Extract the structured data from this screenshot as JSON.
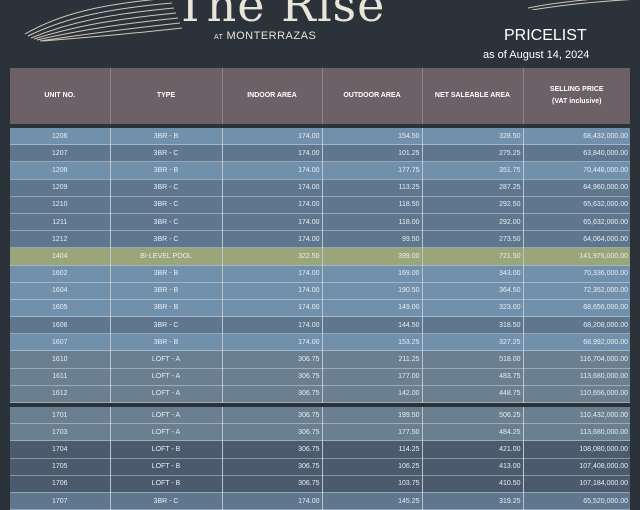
{
  "brand": {
    "title": "The Rise",
    "sub_prefix": "AT",
    "sub_name": "MONTERRAZAS"
  },
  "pricelist": {
    "title": "PRICELIST",
    "date": "as of August 14, 2024"
  },
  "colors": {
    "header_bg": "#2b323a",
    "column_header_bg": "#6b6166",
    "row_light": "#7190ac",
    "row_mid": "#5e778f",
    "row_slate": "#6a7f90",
    "row_dark": "#4b5a6d",
    "row_highlight": "#9aa57a"
  },
  "table": {
    "headers": [
      {
        "line1": "UNIT NO.",
        "line2": ""
      },
      {
        "line1": "TYPE",
        "line2": ""
      },
      {
        "line1": "INDOOR AREA",
        "line2": ""
      },
      {
        "line1": "OUTDOOR AREA",
        "line2": ""
      },
      {
        "line1": "NET SALEABLE AREA",
        "line2": ""
      },
      {
        "line1": "SELLING PRICE",
        "line2": "(VAT inclusive)"
      }
    ],
    "rows": [
      {
        "unit": "1206",
        "type": "3BR - B",
        "indoor": "174.00",
        "outdoor": "154.50",
        "net": "328.50",
        "price": "68,432,000.00",
        "shade": "light"
      },
      {
        "unit": "1207",
        "type": "3BR - C",
        "indoor": "174.00",
        "outdoor": "101.25",
        "net": "275.25",
        "price": "63,840,000.00",
        "shade": "mid"
      },
      {
        "unit": "1208",
        "type": "3BR - B",
        "indoor": "174.00",
        "outdoor": "177.75",
        "net": "351.75",
        "price": "70,448,000.00",
        "shade": "light"
      },
      {
        "unit": "1209",
        "type": "3BR - C",
        "indoor": "174.00",
        "outdoor": "113.25",
        "net": "287.25",
        "price": "64,960,000.00",
        "shade": "mid"
      },
      {
        "unit": "1210",
        "type": "3BR - C",
        "indoor": "174.00",
        "outdoor": "118.50",
        "net": "292.50",
        "price": "65,632,000.00",
        "shade": "mid"
      },
      {
        "unit": "1211",
        "type": "3BR - C",
        "indoor": "174.00",
        "outdoor": "118.00",
        "net": "292.00",
        "price": "65,632,000.00",
        "shade": "mid"
      },
      {
        "unit": "1212",
        "type": "3BR - C",
        "indoor": "174.00",
        "outdoor": "99.50",
        "net": "273.50",
        "price": "64,064,000.00",
        "shade": "mid"
      },
      {
        "unit": "1404",
        "type": "BI-LEVEL POOL",
        "indoor": "322.50",
        "outdoor": "399.00",
        "net": "721.50",
        "price": "141,976,000.00",
        "shade": "highlight"
      },
      {
        "unit": "1602",
        "type": "3BR - B",
        "indoor": "174.00",
        "outdoor": "169.00",
        "net": "343.00",
        "price": "70,336,000.00",
        "shade": "light"
      },
      {
        "unit": "1604",
        "type": "3BR - B",
        "indoor": "174.00",
        "outdoor": "190.50",
        "net": "364.50",
        "price": "72,352,000.00",
        "shade": "light"
      },
      {
        "unit": "1605",
        "type": "3BR - B",
        "indoor": "174.00",
        "outdoor": "149.00",
        "net": "323.00",
        "price": "68,656,000.00",
        "shade": "light"
      },
      {
        "unit": "1606",
        "type": "3BR - C",
        "indoor": "174.00",
        "outdoor": "144.50",
        "net": "318.50",
        "price": "68,208,000.00",
        "shade": "mid"
      },
      {
        "unit": "1607",
        "type": "3BR - B",
        "indoor": "174.00",
        "outdoor": "153.25",
        "net": "327.25",
        "price": "68,992,000.00",
        "shade": "light"
      },
      {
        "unit": "1610",
        "type": "LOFT - A",
        "indoor": "306.75",
        "outdoor": "211.25",
        "net": "518.00",
        "price": "116,704,000.00",
        "shade": "slate"
      },
      {
        "unit": "1611",
        "type": "LOFT - A",
        "indoor": "306.75",
        "outdoor": "177.00",
        "net": "483.75",
        "price": "113,680,000.00",
        "shade": "slate"
      },
      {
        "unit": "1612",
        "type": "LOFT - A",
        "indoor": "306.75",
        "outdoor": "142.00",
        "net": "448.75",
        "price": "110,656,000.00",
        "shade": "slate"
      },
      {
        "unit": "1701",
        "type": "LOFT - A",
        "indoor": "306.75",
        "outdoor": "199.50",
        "net": "506.25",
        "price": "110,432,000.00",
        "shade": "slate",
        "gap_before": true
      },
      {
        "unit": "1703",
        "type": "LOFT - A",
        "indoor": "306.75",
        "outdoor": "177.50",
        "net": "484.25",
        "price": "113,680,000.00",
        "shade": "slate"
      },
      {
        "unit": "1704",
        "type": "LOFT - B",
        "indoor": "306.75",
        "outdoor": "114.25",
        "net": "421.00",
        "price": "108,080,000.00",
        "shade": "dark"
      },
      {
        "unit": "1705",
        "type": "LOFT - B",
        "indoor": "306.75",
        "outdoor": "106.25",
        "net": "413.00",
        "price": "107,408,000.00",
        "shade": "dark"
      },
      {
        "unit": "1706",
        "type": "LOFT - B",
        "indoor": "306.75",
        "outdoor": "103.75",
        "net": "410.50",
        "price": "107,184,000.00",
        "shade": "dark"
      },
      {
        "unit": "1707",
        "type": "3BR - C",
        "indoor": "174.00",
        "outdoor": "145.25",
        "net": "319.25",
        "price": "65,520,000.00",
        "shade": "mid"
      }
    ]
  }
}
